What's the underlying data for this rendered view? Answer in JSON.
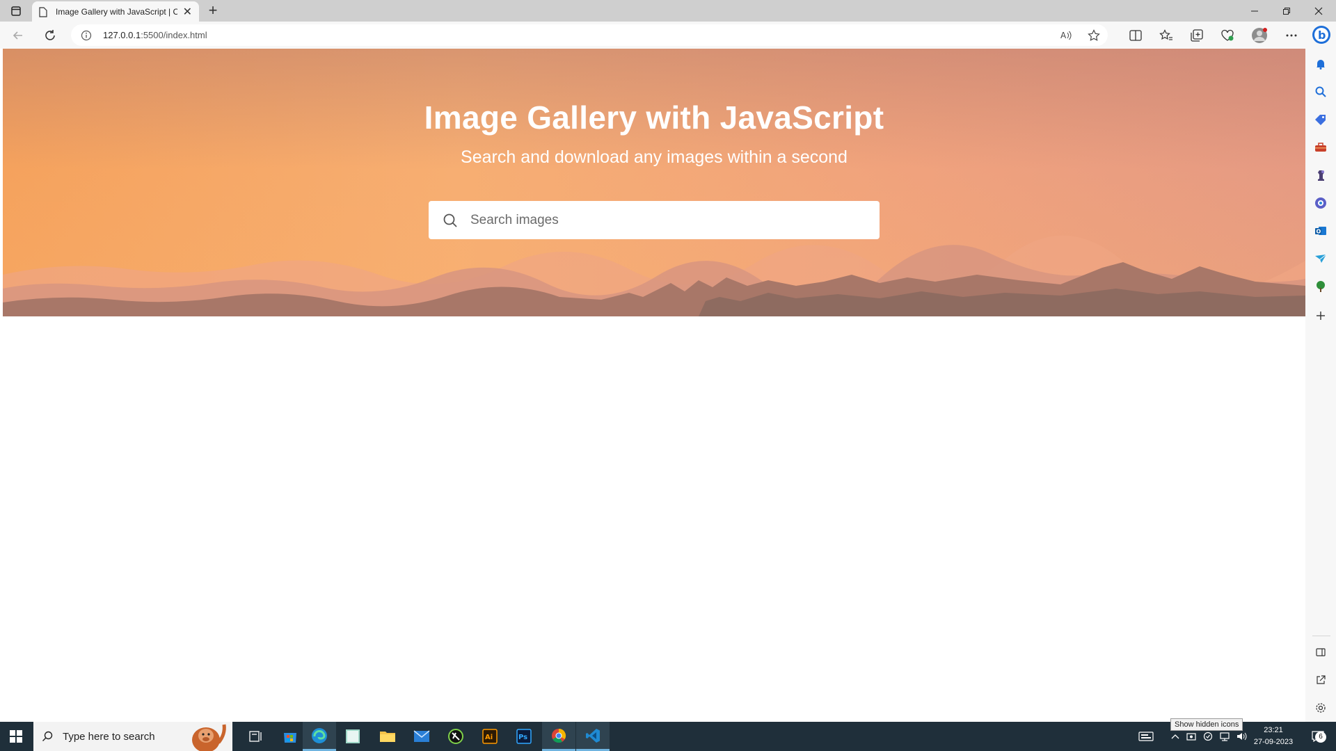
{
  "browser": {
    "tab_title": "Image Gallery with JavaScript | C",
    "url_host": "127.0.0.1",
    "url_path": ":5500/index.html",
    "new_tab_label": "+",
    "close_tab_label": "✕"
  },
  "page": {
    "heading": "Image Gallery with JavaScript",
    "subheading": "Search and download any images within a second",
    "search_placeholder": "Search images"
  },
  "taskbar": {
    "search_text": "Type here to search",
    "time": "23:21",
    "date": "27-09-2023",
    "notification_count": "6",
    "tooltip": "Show hidden icons"
  },
  "colors": {
    "hero_start": "#f5a25d",
    "hero_end": "#e59a83",
    "taskbar_bg": "#1f2f3a"
  }
}
